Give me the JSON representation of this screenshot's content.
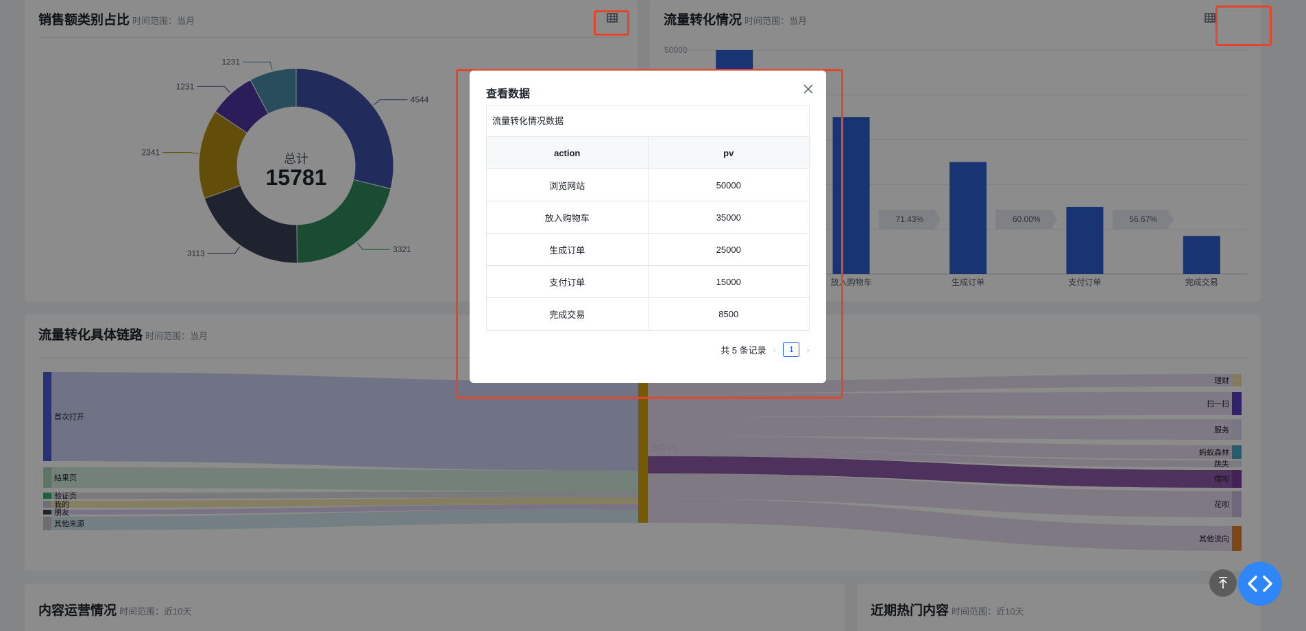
{
  "sales_card": {
    "title": "销售额类别占比",
    "range": "时间范围：当月",
    "center_label": "总计",
    "center_value": "15781"
  },
  "flow_card": {
    "title": "流量转化情况",
    "range": "时间范围：当月",
    "y_tick": "50000"
  },
  "sankey_card": {
    "title": "流量转化具体链路",
    "range": "时间范围：当月"
  },
  "content_card": {
    "title": "内容运营情况",
    "range": "时间范围：近10天"
  },
  "hot_card": {
    "title": "近期热门内容",
    "range": "时间范围：近10天"
  },
  "donut": {
    "labels": [
      "4544",
      "3321",
      "3113",
      "2341",
      "1231",
      "1231"
    ],
    "values": [
      4544,
      3321,
      3113,
      2341,
      1231,
      1231
    ],
    "colors": [
      "#3d4fa8",
      "#2e8a5e",
      "#3a4157",
      "#b38f11",
      "#4d35a2",
      "#4a8ca8"
    ]
  },
  "flow_chart": {
    "type": "bar",
    "categories": [
      "浏览网站",
      "放入购物车",
      "生成订单",
      "支付订单",
      "完成交易"
    ],
    "visible_labels": [
      "放入购物车",
      "生成订单",
      "支付订单",
      "完成交易"
    ],
    "values": [
      50000,
      35000,
      25000,
      15000,
      8500
    ],
    "rates": [
      "71.43%",
      "60.00%",
      "56.67%"
    ],
    "ylim": [
      0,
      50000
    ],
    "color": "#2f5fd0"
  },
  "sankey": {
    "left_nodes": [
      "首次打开",
      "结果页",
      "验证页",
      "我的",
      "朋友",
      "其他来源"
    ],
    "center_node": "首页 UV",
    "right_nodes": [
      "理财",
      "扫一扫",
      "服务",
      "蚂蚁森林",
      "跳失",
      "借呗",
      "花呗",
      "其他流向"
    ]
  },
  "modal": {
    "title": "查看数据",
    "caption": "流量转化情况数据",
    "columns": [
      "action",
      "pv"
    ],
    "rows": [
      [
        "浏览网站",
        "50000"
      ],
      [
        "放入购物车",
        "35000"
      ],
      [
        "生成订单",
        "25000"
      ],
      [
        "支付订单",
        "15000"
      ],
      [
        "完成交易",
        "8500"
      ]
    ],
    "total_text": "共 5 条记录",
    "page": "1"
  },
  "chart_data": {
    "type": "table",
    "title": "流量转化情况数据",
    "columns": [
      "action",
      "pv"
    ],
    "categories": [
      "浏览网站",
      "放入购物车",
      "生成订单",
      "支付订单",
      "完成交易"
    ],
    "values": [
      50000,
      35000,
      25000,
      15000,
      8500
    ]
  }
}
